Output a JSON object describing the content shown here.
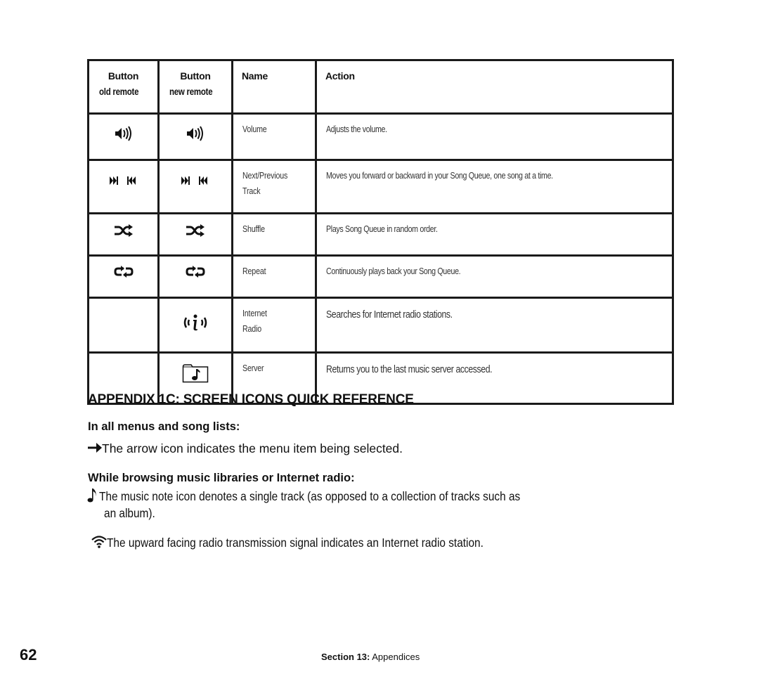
{
  "table": {
    "headers": {
      "old_remote": [
        "Button",
        "old remote"
      ],
      "new_remote": [
        "Button",
        "new remote"
      ],
      "name": "Name",
      "action": "Action"
    },
    "rows": [
      {
        "old_icon": "volume-icon",
        "new_icon": "volume-icon",
        "name": [
          "Volume"
        ],
        "action": "Adjusts the volume."
      },
      {
        "old_icon": "next-previous-track-icon",
        "new_icon": "next-previous-track-icon",
        "name": [
          "Next/Previous",
          "Track"
        ],
        "action": "Moves you forward or backward in your Song Queue, one song at a time."
      },
      {
        "old_icon": "shuffle-icon",
        "new_icon": "shuffle-icon",
        "name": [
          "Shuffle"
        ],
        "action": "Plays Song Queue in random order."
      },
      {
        "old_icon": "repeat-icon",
        "new_icon": "repeat-icon",
        "name": [
          "Repeat"
        ],
        "action": "Continuously plays back your Song Queue."
      },
      {
        "old_icon": null,
        "new_icon": "internet-radio-icon",
        "name": [
          "Internet",
          "Radio"
        ],
        "action": "Searches for Internet radio stations."
      },
      {
        "old_icon": null,
        "new_icon": "server-folder-music-icon",
        "name": [
          "Server"
        ],
        "action": "Returns you to the last music server accessed."
      }
    ]
  },
  "appendix": {
    "title": "APPENDIX 1C: SCREEN ICONS QUICK REFERENCE",
    "sections": [
      {
        "heading": "In all menus and song lists:",
        "items": [
          {
            "icon": "right-arrow-icon",
            "text": "The arrow icon indicates the menu item being selected."
          }
        ]
      },
      {
        "heading": "While browsing music libraries or Internet radio:",
        "items": [
          {
            "icon": "music-note-icon",
            "text_line1": "The music note icon denotes a single track (as opposed to a collection of tracks such as",
            "text_line2": "an album)."
          },
          {
            "icon": "radio-signal-icon",
            "text": "The upward facing radio transmission signal indicates an Internet radio station."
          }
        ]
      }
    ]
  },
  "footer": {
    "page_number": "62",
    "section_label": "Section 13:",
    "section_name": "Appendices"
  }
}
